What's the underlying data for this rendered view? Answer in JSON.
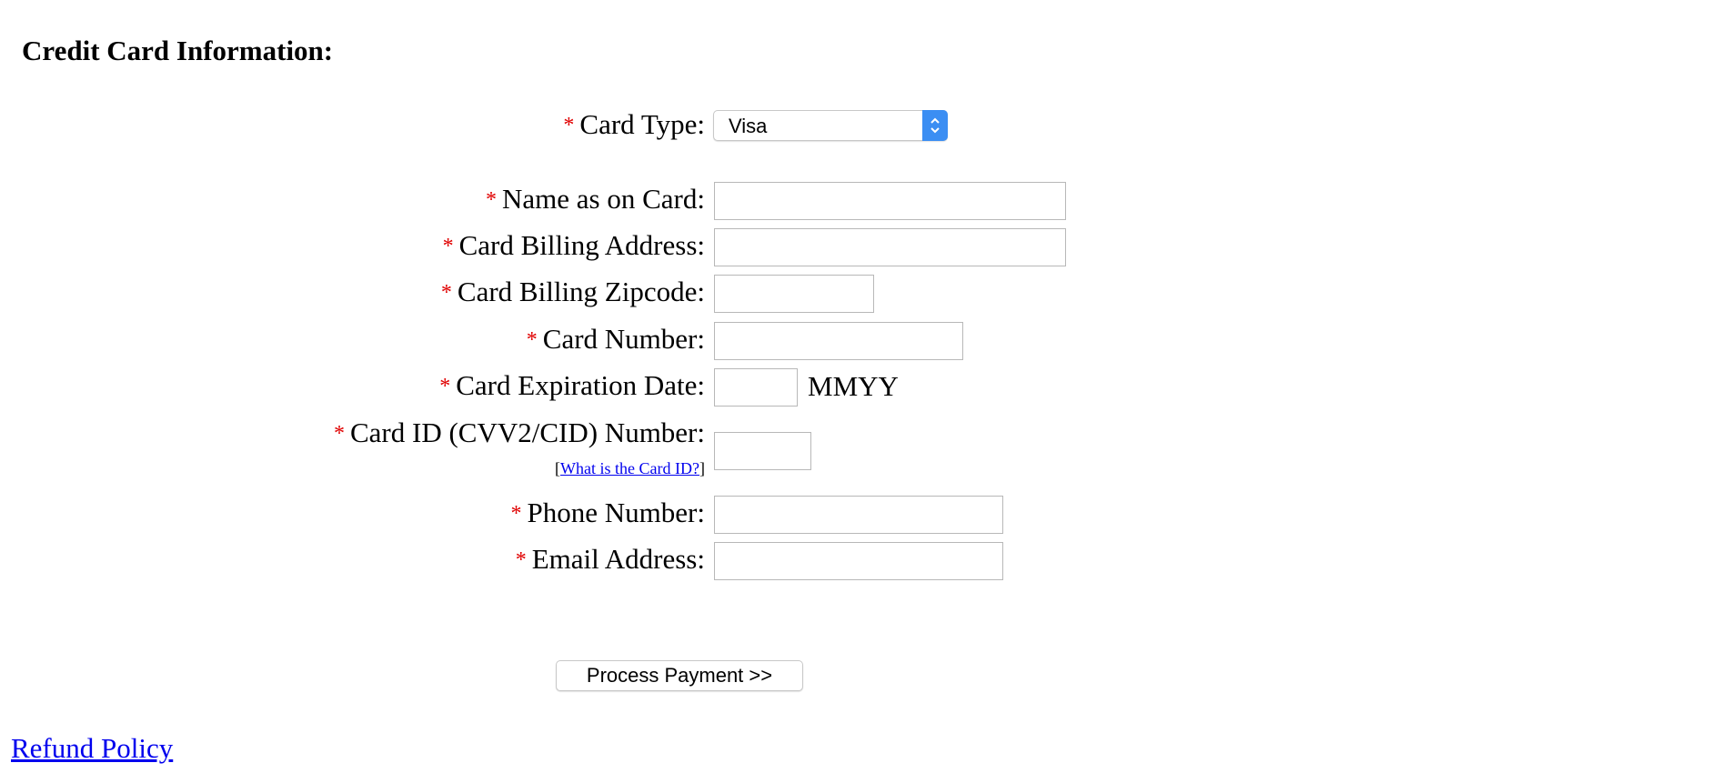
{
  "section": {
    "title": "Credit Card Information:"
  },
  "required_marker": "*",
  "colors": {
    "required": "#e00000",
    "link": "#0000ee",
    "select_accent": "#3b8ef3"
  },
  "fields": {
    "card_type": {
      "label": "Card Type:",
      "selected": "Visa"
    },
    "name_on_card": {
      "label": "Name as on Card:",
      "value": ""
    },
    "billing_address": {
      "label": "Card Billing Address:",
      "value": ""
    },
    "billing_zipcode": {
      "label": "Card Billing Zipcode:",
      "value": ""
    },
    "card_number": {
      "label": "Card Number:",
      "value": ""
    },
    "expiration_date": {
      "label": "Card Expiration Date:",
      "value": "",
      "format_hint": "MMYY"
    },
    "card_id": {
      "label": "Card ID (CVV2/CID) Number:",
      "value": "",
      "help_open": "[",
      "help_link": "What is the Card ID?",
      "help_close": "]"
    },
    "phone_number": {
      "label": "Phone Number:",
      "value": ""
    },
    "email_address": {
      "label": "Email Address:",
      "value": ""
    }
  },
  "submit": {
    "label": "Process Payment >>"
  },
  "footer": {
    "refund_link": "Refund Policy"
  },
  "icons": {
    "select_arrow": "chevron-updown-icon"
  }
}
